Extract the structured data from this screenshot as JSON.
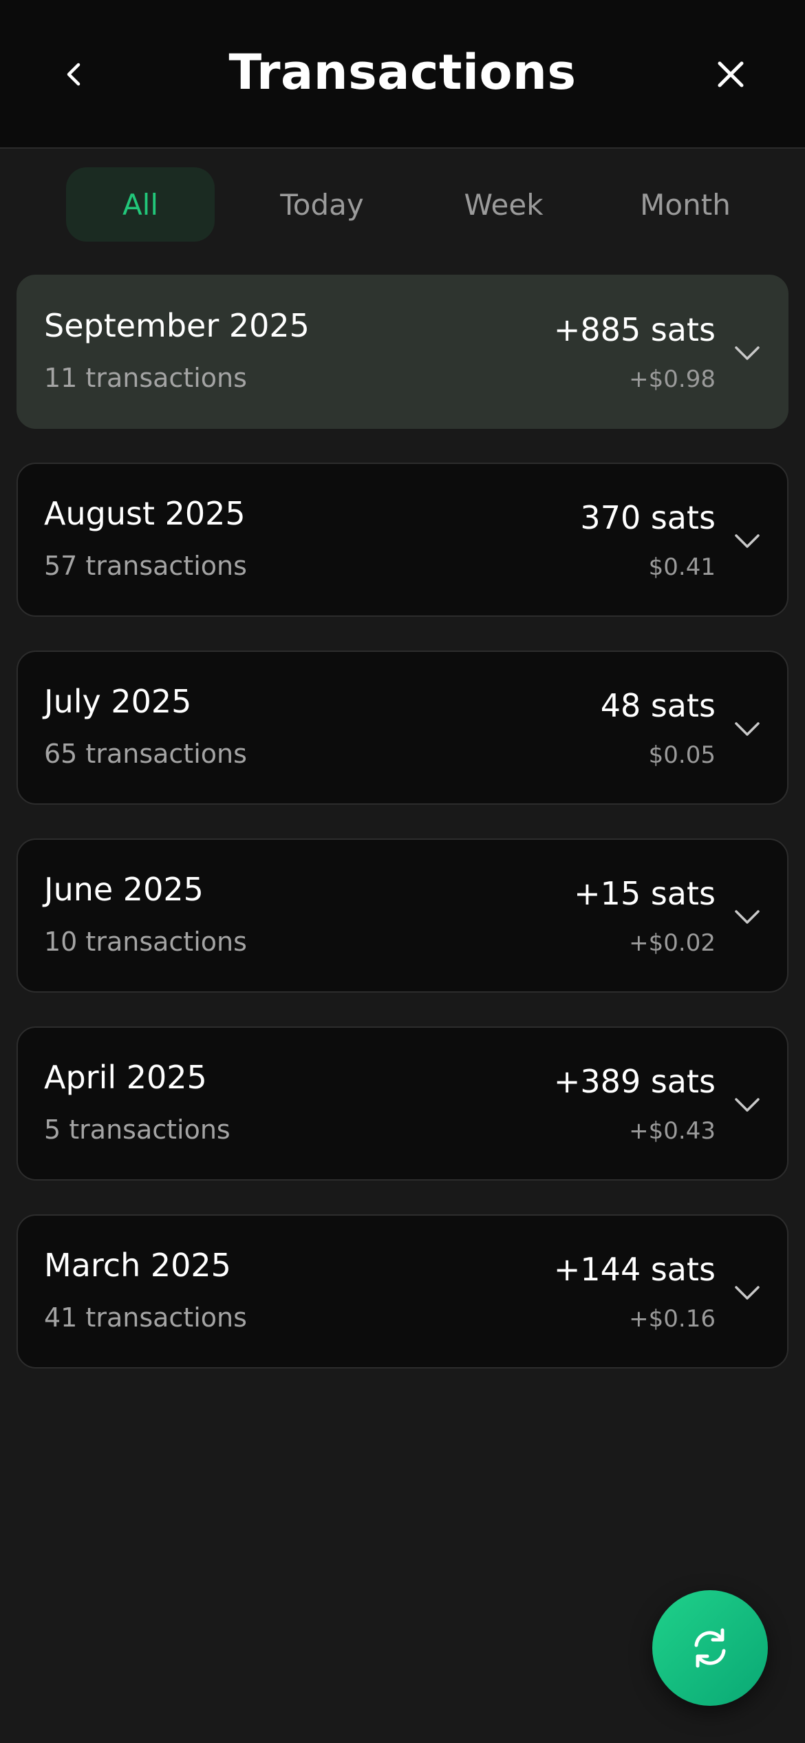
{
  "header": {
    "title": "Transactions",
    "back_icon": "chevron-left-icon",
    "close_icon": "close-icon"
  },
  "tabs": [
    {
      "label": "All",
      "active": true
    },
    {
      "label": "Today",
      "active": false
    },
    {
      "label": "Week",
      "active": false
    },
    {
      "label": "Month",
      "active": false
    }
  ],
  "groups": [
    {
      "month": "September 2025",
      "count": "11 transactions",
      "sats": "+885 sats",
      "usd": "+$0.98"
    },
    {
      "month": "August 2025",
      "count": "57 transactions",
      "sats": "370 sats",
      "usd": "$0.41"
    },
    {
      "month": "July 2025",
      "count": "65 transactions",
      "sats": "48 sats",
      "usd": "$0.05"
    },
    {
      "month": "June 2025",
      "count": "10 transactions",
      "sats": "+15 sats",
      "usd": "+$0.02"
    },
    {
      "month": "April 2025",
      "count": "5 transactions",
      "sats": "+389 sats",
      "usd": "+$0.43"
    },
    {
      "month": "March 2025",
      "count": "41 transactions",
      "sats": "+144 sats",
      "usd": "+$0.16"
    }
  ],
  "fab": {
    "icon": "refresh-icon"
  },
  "colors": {
    "accent": "#22c77a",
    "background": "#191919",
    "header_background": "#0b0b0b",
    "card_background": "#0c0c0c",
    "highlight_card_background": "#2e342f"
  }
}
